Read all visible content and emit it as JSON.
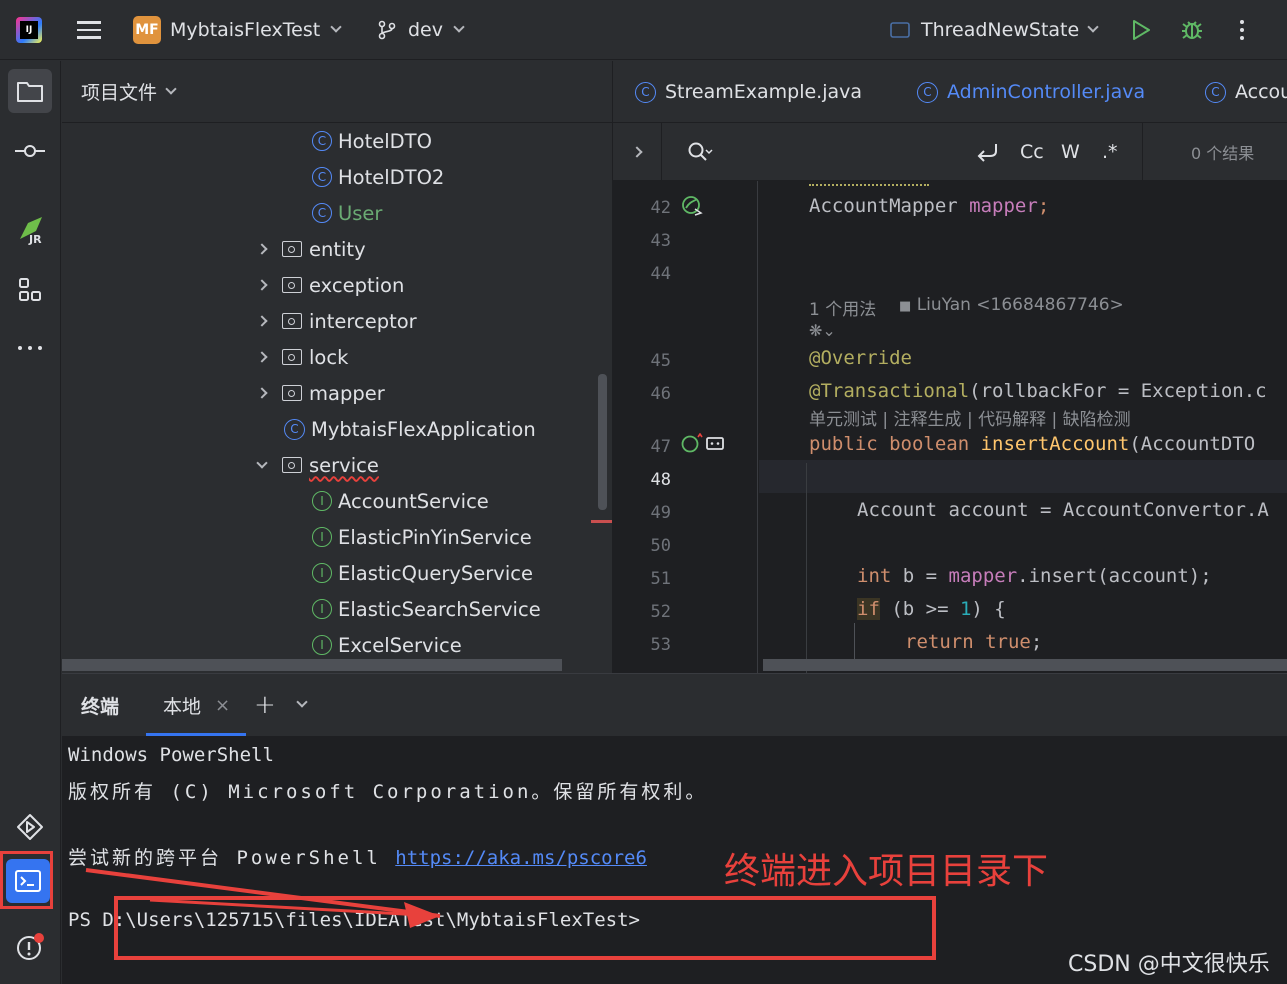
{
  "topbar": {
    "project_badge": "MF",
    "project_name": "MybtaisFlexTest",
    "branch": "dev",
    "run_config": "ThreadNewState"
  },
  "project_panel": {
    "title": "项目文件",
    "items": [
      {
        "label": "HotelDTO",
        "kind": "class"
      },
      {
        "label": "HotelDTO2",
        "kind": "class"
      },
      {
        "label": "User",
        "kind": "class"
      },
      {
        "label": "entity",
        "kind": "folder"
      },
      {
        "label": "exception",
        "kind": "folder"
      },
      {
        "label": "interceptor",
        "kind": "folder"
      },
      {
        "label": "lock",
        "kind": "folder"
      },
      {
        "label": "mapper",
        "kind": "folder"
      },
      {
        "label": "MybtaisFlexApplication",
        "kind": "app"
      },
      {
        "label": "service",
        "kind": "folder-open"
      },
      {
        "label": "AccountService",
        "kind": "interface"
      },
      {
        "label": "ElasticPinYinService",
        "kind": "interface"
      },
      {
        "label": "ElasticQueryService",
        "kind": "interface"
      },
      {
        "label": "ElasticSearchService",
        "kind": "interface"
      },
      {
        "label": "ExcelService",
        "kind": "interface"
      }
    ]
  },
  "editor": {
    "tabs": [
      "StreamExample.java",
      "AdminController.java",
      "Accou"
    ],
    "find": {
      "match_case": "Cc",
      "words": "W",
      "regex": ".*",
      "results": "0 个结果"
    },
    "line_numbers": [
      "42",
      "43",
      "44",
      "45",
      "46",
      "47",
      "48",
      "49",
      "50",
      "51",
      "52",
      "53"
    ],
    "usages_hint": "1 个用法",
    "author_hint": "LiuYan <16684867746>",
    "ai_actions": "单元测试 | 注释生成 | 代码解释 | 缺陷检测",
    "code": {
      "l42_type": "AccountMapper",
      "l42_field": "mapper",
      "l45": "@Override",
      "l46_ann": "@Transactional",
      "l46_rest": "(rollbackFor = Exception.c",
      "l47_kw": "public boolean",
      "l47_fn": "insertAccount",
      "l47_rest": "(AccountDTO",
      "l49": "Account account = AccountConvertor.A",
      "l51_kw": "int",
      "l51_rest_a": " b = ",
      "l51_field": "mapper",
      "l51_rest_b": ".insert(account);",
      "l52_kw": "if",
      "l52_rest_a": " (b >= ",
      "l52_num": "1",
      "l52_rest_b": ") {",
      "l53_kw": "return true",
      "l53_rest": ";"
    }
  },
  "terminal": {
    "title": "终端",
    "tab_label": "本地",
    "lines": {
      "l1": "Windows PowerShell",
      "l2": "版权所有 (C) Microsoft Corporation。保留所有权利。",
      "l3_prefix": "尝试新的跨平台 PowerShell ",
      "l3_link": "https://aka.ms/pscore6",
      "prompt": "PS D:\\Users\\125715\\files\\IDEATest\\MybtaisFlexTest>"
    }
  },
  "annotation": {
    "text": "终端进入项目目录下",
    "color": "#e8413c"
  },
  "watermark": "CSDN @中文很快乐"
}
